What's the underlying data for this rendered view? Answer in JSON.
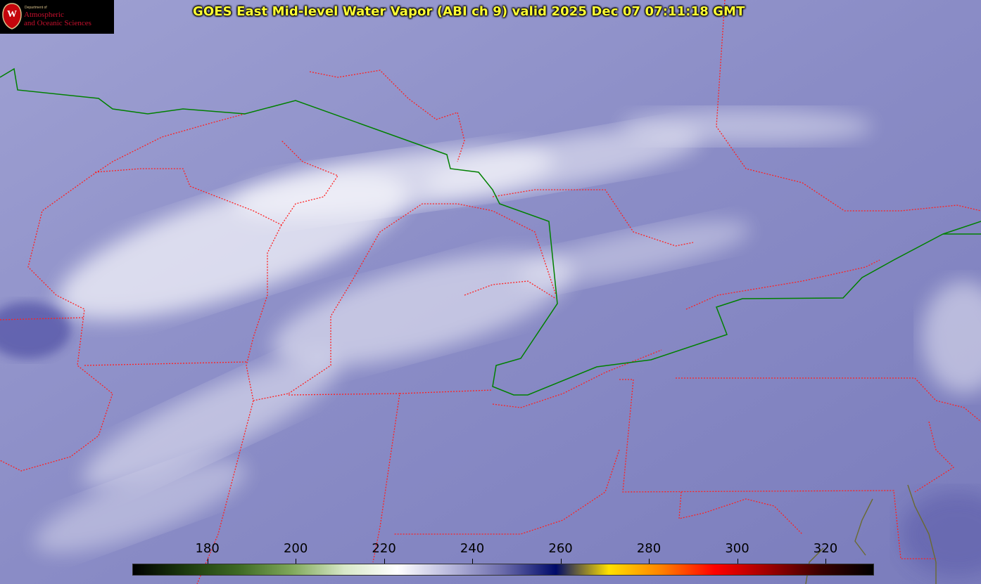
{
  "title": "GOES East Mid-level Water Vapor (ABI ch 9)  valid 2025 Dec 07 07:11:18 GMT",
  "logo": {
    "dept_line": "Department of",
    "line1": "Atmospheric",
    "line2": "and Oceanic Sciences",
    "seal_letter": "W"
  },
  "colorbar": {
    "tick_values": [
      180,
      200,
      220,
      240,
      260,
      280,
      300,
      320
    ],
    "tick_labels": [
      "180",
      "200",
      "220",
      "240",
      "260",
      "280",
      "300",
      "320"
    ],
    "colors": [
      "#000000",
      "#1c3a0e",
      "#3e6a24",
      "#7fa85a",
      "#d8e8c8",
      "#ffffff",
      "#b8b8dc",
      "#6a6aaa",
      "#000a6a",
      "#ffe000",
      "#ff8000",
      "#ff0000",
      "#a00000",
      "#3a0000",
      "#000000"
    ]
  },
  "map": {
    "cloud_color": "#ffffff",
    "background_color": "#8a8cc4",
    "state_border_color": "#ff2020",
    "country_border_color": "#008000"
  }
}
